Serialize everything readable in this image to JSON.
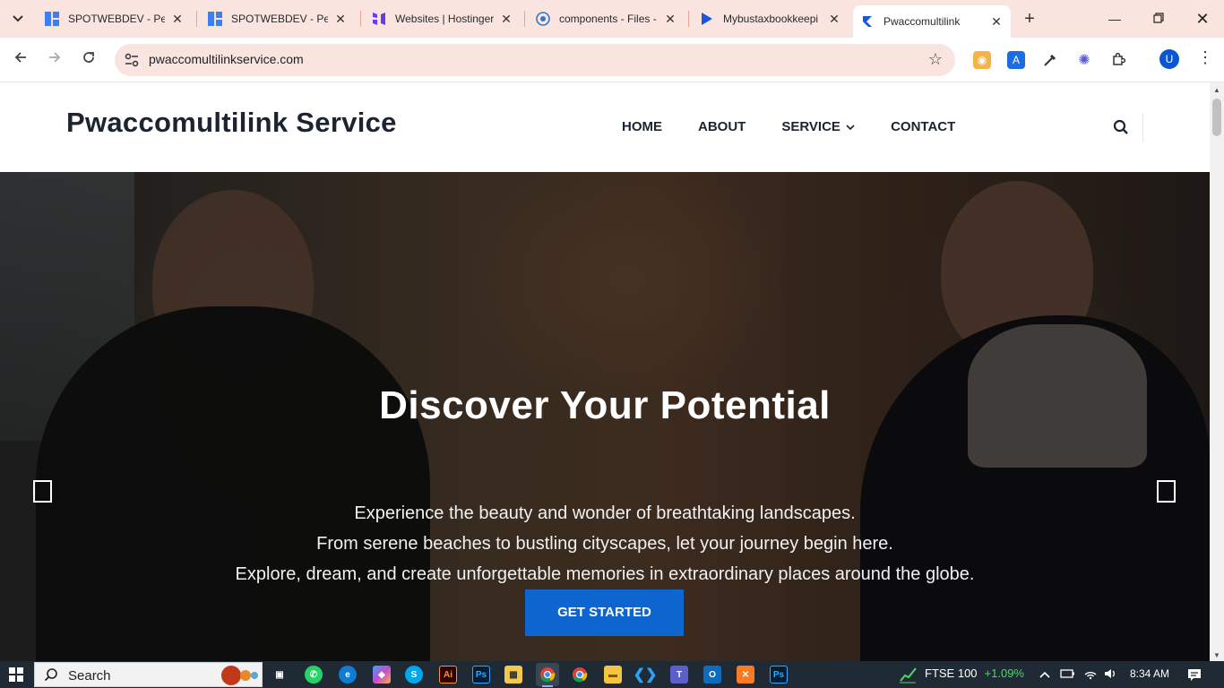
{
  "browser": {
    "tabs": [
      {
        "title": "SPOTWEBDEV - Pers",
        "icon": "elementor-icon",
        "color": "#3d7ef6"
      },
      {
        "title": "SPOTWEBDEV - Pers",
        "icon": "elementor-icon",
        "color": "#3d7ef6"
      },
      {
        "title": "Websites | Hostinger",
        "icon": "hostinger-icon",
        "color": "#673de6"
      },
      {
        "title": "components - Files -",
        "icon": "files-icon",
        "color": "#3178c6"
      },
      {
        "title": "Mybustaxbookkeepi",
        "icon": "kadence-icon",
        "color": "#1a56db"
      },
      {
        "title": "Pwaccomultilink",
        "icon": "kadence-icon",
        "color": "#1a56db"
      }
    ],
    "url": "pwaccomultilinkservice.com",
    "profile_initial": "U"
  },
  "site": {
    "brand": "Pwaccomultilink Service",
    "menu": {
      "home": "HOME",
      "about": "ABOUT",
      "service": "SERVICE",
      "contact": "CONTACT"
    }
  },
  "hero": {
    "title": "Discover Your Potential",
    "lines": [
      "Experience the beauty and wonder of breathtaking landscapes.",
      "From serene beaches to bustling cityscapes, let your journey begin here.",
      "Explore, dream, and create unforgettable memories in extraordinary places around the globe."
    ],
    "cta": "GET STARTED",
    "accent_color": "#0d66d0"
  },
  "taskbar": {
    "search_label": "Search",
    "ticker_name": "FTSE 100",
    "ticker_change": "+1.09%",
    "time": "8:34 AM"
  }
}
